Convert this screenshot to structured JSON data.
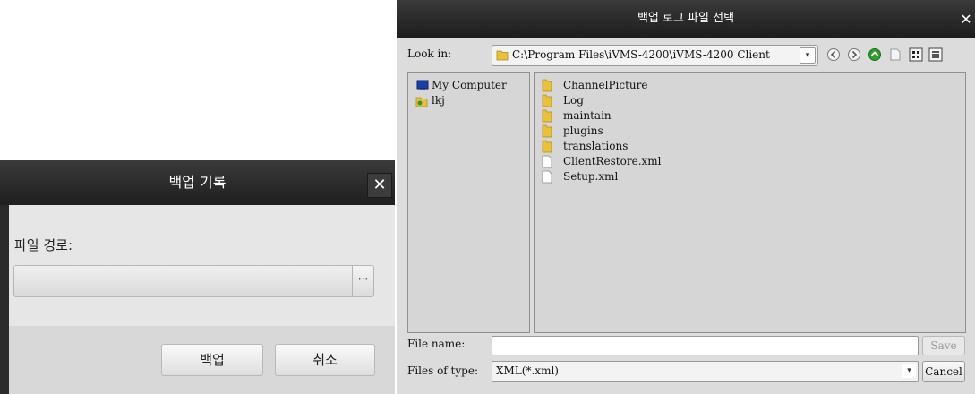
{
  "backup_dialog": {
    "title": "백업 기록",
    "close_glyph": "✕",
    "file_path_label": "파일 경로:",
    "file_path_value": "",
    "browse_label": "···",
    "backup_button": "백업",
    "cancel_button": "취소"
  },
  "file_dialog": {
    "title": "백업 로그 파일 선택",
    "close_glyph": "✕",
    "look_in_label": "Look in:",
    "look_in_value": "C:\\Program Files\\iVMS-4200\\iVMS-4200 Client",
    "nav_icons": [
      "back-icon",
      "forward-icon",
      "up-icon",
      "new-folder-icon",
      "list-view-icon",
      "detail-view-icon"
    ],
    "sidebar": [
      {
        "label": "My Computer",
        "icon": "computer-icon"
      },
      {
        "label": "lkj",
        "icon": "user-icon"
      }
    ],
    "entries": [
      {
        "name": "ChannelPicture",
        "type": "folder"
      },
      {
        "name": "Log",
        "type": "folder"
      },
      {
        "name": "maintain",
        "type": "folder"
      },
      {
        "name": "plugins",
        "type": "folder"
      },
      {
        "name": "translations",
        "type": "folder"
      },
      {
        "name": "ClientRestore.xml",
        "type": "file"
      },
      {
        "name": "Setup.xml",
        "type": "file"
      }
    ],
    "file_name_label": "File name:",
    "file_name_value": "",
    "save_button": "Save",
    "files_of_type_label": "Files of type:",
    "files_of_type_value": "XML(*.xml)",
    "cancel_button": "Cancel"
  },
  "colors": {
    "titlebar": "#2b2b2b",
    "dialog_body": "#e6e6e6",
    "pane": "#d6d6d6",
    "folder": "#e8c23a",
    "accent_green": "#2f9e2f"
  }
}
